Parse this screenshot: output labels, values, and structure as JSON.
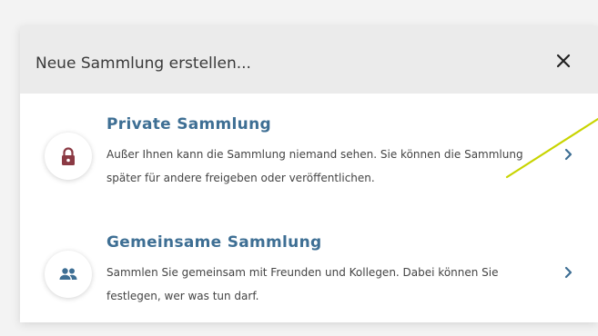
{
  "dialog": {
    "title": "Neue Sammlung erstellen...",
    "close_icon": "close-icon"
  },
  "options": [
    {
      "title": "Private Sammlung",
      "description": "Außer Ihnen kann die Sammlung niemand sehen. Sie können die Sammlung später für andere freigeben oder veröffentlichen.",
      "icon": "lock-icon",
      "icon_color": "#8b3a44"
    },
    {
      "title": "Gemeinsame Sammlung",
      "description": "Sammlen Sie gemeinsam mit Freunden und Kollegen. Dabei können Sie festlegen, wer was tun darf.",
      "icon": "people-icon",
      "icon_color": "#3e6f94"
    }
  ],
  "colors": {
    "accent": "#3e6f94",
    "annotation_line": "#c8d400"
  }
}
